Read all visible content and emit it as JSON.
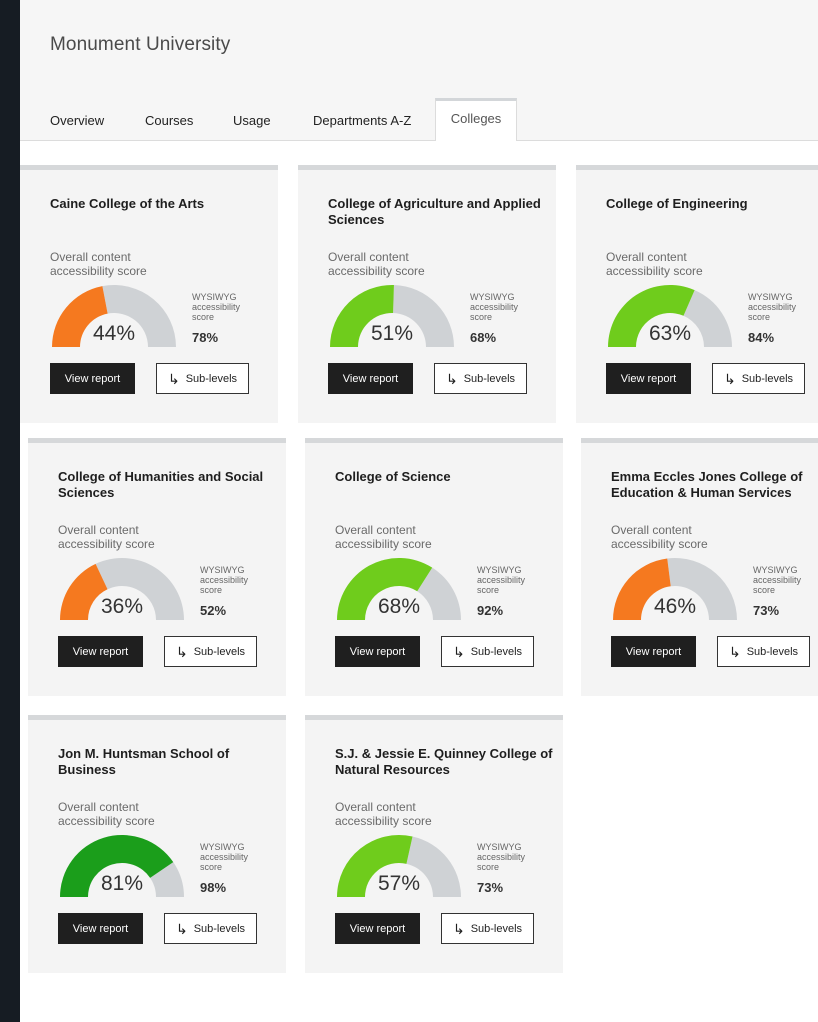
{
  "app": {
    "title": "Monument University"
  },
  "tabs": [
    {
      "label": "Overview"
    },
    {
      "label": "Courses"
    },
    {
      "label": "Usage"
    },
    {
      "label": "Departments A-Z"
    },
    {
      "label": "Colleges",
      "active": true
    }
  ],
  "labels": {
    "overall": "Overall content accessibility score",
    "wysiwyg": "WYSIWYG accessibility score",
    "view_report": "View report",
    "sub_levels": "Sub-levels"
  },
  "colors": {
    "orange": "#f5791f",
    "green": "#6fcc1c",
    "dark_green": "#1b9e1b",
    "track": "#cfd2d5"
  },
  "colleges": [
    {
      "name": "Caine College of the Arts",
      "overall": 44,
      "overall_text": "44%",
      "wysiwyg": "78%",
      "color": "#f5791f"
    },
    {
      "name": "College of Agriculture and Applied Sciences",
      "overall": 51,
      "overall_text": "51%",
      "wysiwyg": "68%",
      "color": "#6fcc1c"
    },
    {
      "name": "College of Engineering",
      "overall": 63,
      "overall_text": "63%",
      "wysiwyg": "84%",
      "color": "#6fcc1c"
    },
    {
      "name": "College of Humanities and Social Sciences",
      "overall": 36,
      "overall_text": "36%",
      "wysiwyg": "52%",
      "color": "#f5791f"
    },
    {
      "name": "College of Science",
      "overall": 68,
      "overall_text": "68%",
      "wysiwyg": "92%",
      "color": "#6fcc1c"
    },
    {
      "name": "Emma Eccles Jones College of Education & Human Services",
      "overall": 46,
      "overall_text": "46%",
      "wysiwyg": "73%",
      "color": "#f5791f"
    },
    {
      "name": "Jon M. Huntsman School of Business",
      "overall": 81,
      "overall_text": "81%",
      "wysiwyg": "98%",
      "color": "#1b9e1b"
    },
    {
      "name": "S.J. & Jessie E. Quinney College of Natural Resources",
      "overall": 57,
      "overall_text": "57%",
      "wysiwyg": "73%",
      "color": "#6fcc1c"
    }
  ]
}
